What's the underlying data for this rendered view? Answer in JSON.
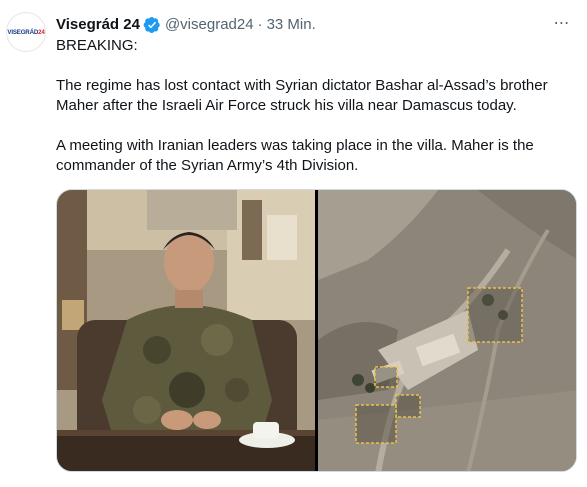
{
  "tweet": {
    "avatar_text_a": "VISEGRÁD",
    "avatar_text_b": "24",
    "display_name": "Visegrád 24",
    "handle": "@visegrad24",
    "separator": "·",
    "time": "33 Min.",
    "more_icon": "⋯",
    "paragraphs": [
      "BREAKING:",
      "The regime has lost contact with Syrian dictator Bashar al-Assad’s brother Maher after the Israeli Air Force struck his villa near Damascus today.",
      "A meeting with Iranian leaders was taking place in the villa. Maher is the commander of the Syrian Army’s 4th Division."
    ]
  },
  "colors": {
    "verified": "#1d9bf0",
    "secondary_text": "#536471",
    "primary_text": "#0f1419",
    "highlight_box": "#e8c24a"
  },
  "icons": {
    "verified": "verified-badge-icon",
    "more": "more-options-icon"
  }
}
